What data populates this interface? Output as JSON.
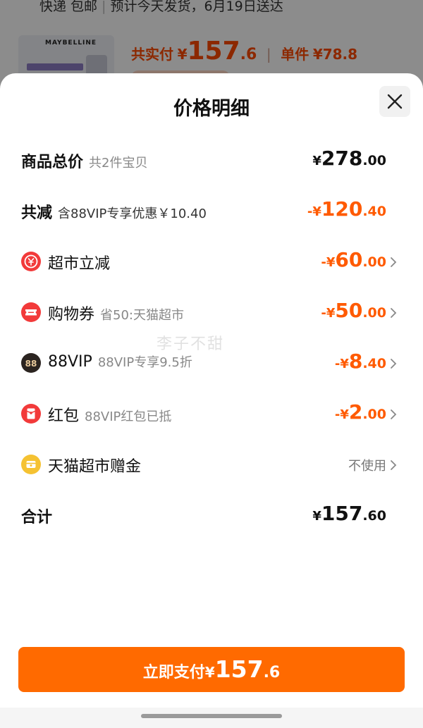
{
  "background": {
    "delivery": {
      "method": "快递 包邮",
      "estimate": "预计今天发货，6月19日送达"
    },
    "product_brand": "MAYBELLINE",
    "total_label": "共实付",
    "currency": "¥",
    "total_int": "157",
    "total_dec": ".6",
    "unit_label": "单件",
    "unit_price": "¥78.8"
  },
  "sheet": {
    "title": "价格明细",
    "watermark": "李子不甜",
    "rows": [
      {
        "label": "商品总价",
        "sub": "共2件宝贝",
        "currency": "¥",
        "int": "278",
        "dec": ".00"
      },
      {
        "label": "共减",
        "sub": "含88VIP专享优惠￥10.40",
        "currency": "-¥",
        "int": "120",
        "dec": ".40"
      },
      {
        "label": "超市立减",
        "sub": "",
        "currency": "-¥",
        "int": "60",
        "dec": ".00",
        "icon": "yuan-coin-icon"
      },
      {
        "label": "购物券",
        "sub": "省50:天猫超市",
        "currency": "-¥",
        "int": "50",
        "dec": ".00",
        "icon": "coupon-icon"
      },
      {
        "label": "88VIP",
        "sub": "88VIP专享9.5折",
        "currency": "-¥",
        "int": "8",
        "dec": ".40",
        "icon": "vip-88-icon"
      },
      {
        "label": "红包",
        "sub": "88VIP红包已抵",
        "currency": "-¥",
        "int": "2",
        "dec": ".00",
        "icon": "red-envelope-icon"
      },
      {
        "label": "天猫超市赠金",
        "sub": "",
        "value_text": "不使用",
        "icon": "gift-money-icon"
      },
      {
        "label": "合计",
        "sub": "",
        "currency": "¥",
        "int": "157",
        "dec": ".60"
      }
    ],
    "pay_button": {
      "label": "立即支付",
      "currency": "¥",
      "int": "157",
      "dec": ".6"
    }
  },
  "colors": {
    "accent": "#ff6a00",
    "discount": "#ff5a00"
  }
}
